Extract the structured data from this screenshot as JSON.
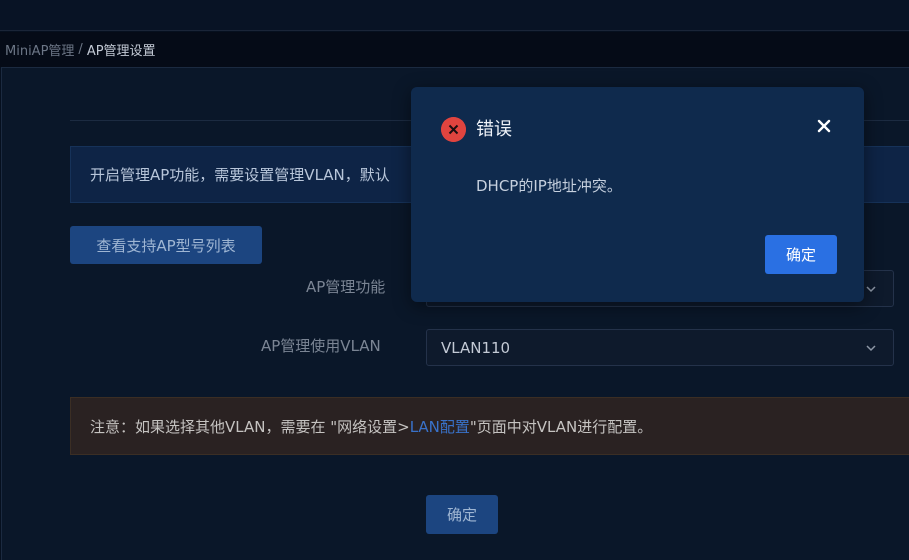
{
  "breadcrumb": {
    "root": "MiniAP管理",
    "separator": "/",
    "current": "AP管理设置"
  },
  "info_banner": {
    "text": "开启管理AP功能，需要设置管理VLAN，默认"
  },
  "buttons": {
    "view_models": "查看支持AP型号列表",
    "confirm": "确定"
  },
  "form": {
    "ap_function_label": "AP管理功能",
    "ap_function_value": "",
    "vlan_label": "AP管理使用VLAN",
    "vlan_value": "VLAN110"
  },
  "warning": {
    "prefix": "注意：如果选择其他VLAN，需要在 \"网络设置>",
    "link": "LAN配置",
    "suffix": "\"页面中对VLAN进行配置。"
  },
  "dialog": {
    "title": "错误",
    "message": "DHCP的IP地址冲突。",
    "ok_label": "确定",
    "icon": "error-circle-x-icon",
    "close_icon": "close-icon"
  },
  "colors": {
    "accent": "#2a70e3",
    "error": "#e0443f",
    "link": "#3972c9"
  }
}
